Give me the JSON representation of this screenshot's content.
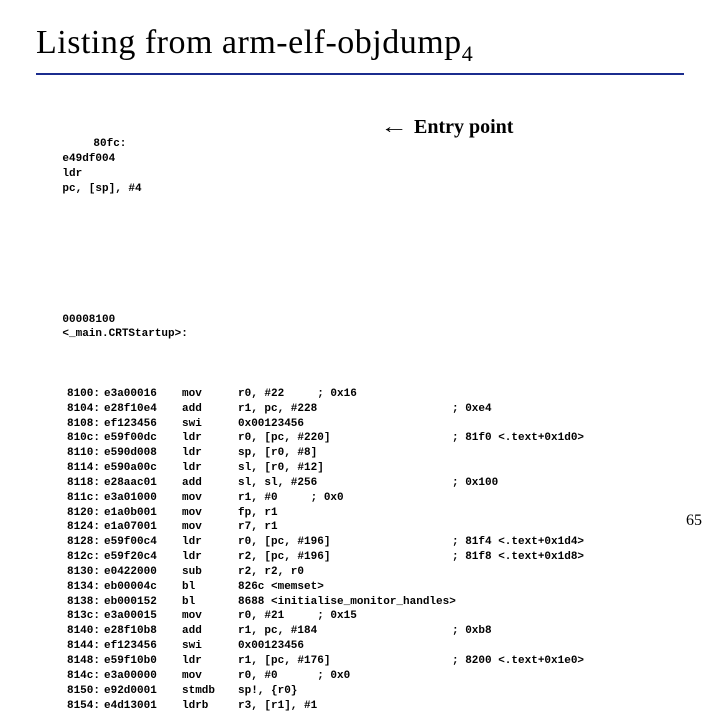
{
  "title": "Listing from arm-elf-objdump",
  "title_sub": "4",
  "annotation": {
    "arrow": "←",
    "text": "Entry point"
  },
  "preamble": {
    "addr": "80fc:",
    "hex": "e49df004",
    "mnem": "ldr",
    "arg": "pc, [sp], #4",
    "cmt": ""
  },
  "symbol": {
    "addr": "00008100",
    "label": "<_main.CRTStartup>:"
  },
  "rows": [
    {
      "addr": "8100:",
      "hex": "e3a00016",
      "mnem": "mov",
      "arg": "r0, #22     ; 0x16",
      "cmt": ""
    },
    {
      "addr": "8104:",
      "hex": "e28f10e4",
      "mnem": "add",
      "arg": "r1, pc, #228",
      "cmt": "; 0xe4"
    },
    {
      "addr": "8108:",
      "hex": "ef123456",
      "mnem": "swi",
      "arg": "0x00123456",
      "cmt": ""
    },
    {
      "addr": "810c:",
      "hex": "e59f00dc",
      "mnem": "ldr",
      "arg": "r0, [pc, #220]",
      "cmt": "; 81f0 <.text+0x1d0>"
    },
    {
      "addr": "8110:",
      "hex": "e590d008",
      "mnem": "ldr",
      "arg": "sp, [r0, #8]",
      "cmt": ""
    },
    {
      "addr": "8114:",
      "hex": "e590a00c",
      "mnem": "ldr",
      "arg": "sl, [r0, #12]",
      "cmt": ""
    },
    {
      "addr": "8118:",
      "hex": "e28aac01",
      "mnem": "add",
      "arg": "sl, sl, #256",
      "cmt": "; 0x100"
    },
    {
      "addr": "811c:",
      "hex": "e3a01000",
      "mnem": "mov",
      "arg": "r1, #0     ; 0x0",
      "cmt": ""
    },
    {
      "addr": "8120:",
      "hex": "e1a0b001",
      "mnem": "mov",
      "arg": "fp, r1",
      "cmt": ""
    },
    {
      "addr": "8124:",
      "hex": "e1a07001",
      "mnem": "mov",
      "arg": "r7, r1",
      "cmt": ""
    },
    {
      "addr": "8128:",
      "hex": "e59f00c4",
      "mnem": "ldr",
      "arg": "r0, [pc, #196]",
      "cmt": "; 81f4 <.text+0x1d4>"
    },
    {
      "addr": "812c:",
      "hex": "e59f20c4",
      "mnem": "ldr",
      "arg": "r2, [pc, #196]",
      "cmt": "; 81f8 <.text+0x1d8>"
    },
    {
      "addr": "8130:",
      "hex": "e0422000",
      "mnem": "sub",
      "arg": "r2, r2, r0",
      "cmt": ""
    },
    {
      "addr": "8134:",
      "hex": "eb00004c",
      "mnem": "bl",
      "arg": "826c <memset>",
      "cmt": ""
    },
    {
      "addr": "8138:",
      "hex": "eb000152",
      "mnem": "bl",
      "arg": "8688 <initialise_monitor_handles>",
      "cmt": ""
    },
    {
      "addr": "813c:",
      "hex": "e3a00015",
      "mnem": "mov",
      "arg": "r0, #21     ; 0x15",
      "cmt": ""
    },
    {
      "addr": "8140:",
      "hex": "e28f10b8",
      "mnem": "add",
      "arg": "r1, pc, #184",
      "cmt": "; 0xb8"
    },
    {
      "addr": "8144:",
      "hex": "ef123456",
      "mnem": "swi",
      "arg": "0x00123456",
      "cmt": ""
    },
    {
      "addr": "8148:",
      "hex": "e59f10b0",
      "mnem": "ldr",
      "arg": "r1, [pc, #176]",
      "cmt": "; 8200 <.text+0x1e0>"
    },
    {
      "addr": "814c:",
      "hex": "e3a00000",
      "mnem": "mov",
      "arg": "r0, #0      ; 0x0",
      "cmt": ""
    },
    {
      "addr": "8150:",
      "hex": "e92d0001",
      "mnem": "stmdb",
      "arg": "sp!, {r0}",
      "cmt": ""
    },
    {
      "addr": "8154:",
      "hex": "e4d13001",
      "mnem": "ldrb",
      "arg": "r3, [r1], #1",
      "cmt": ""
    }
  ],
  "page_number": "65"
}
